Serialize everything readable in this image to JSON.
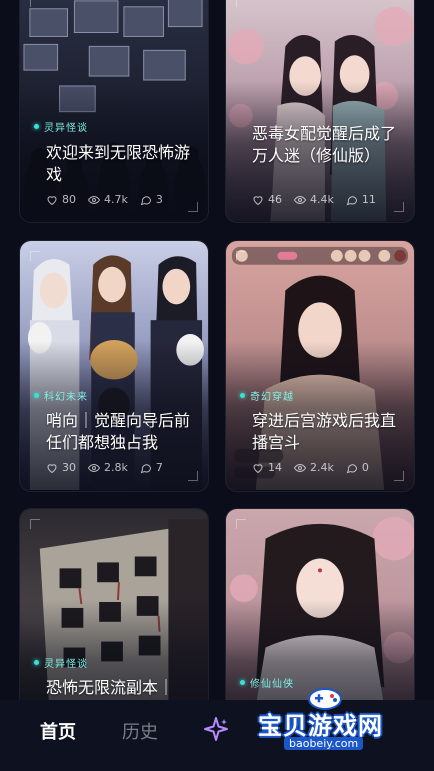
{
  "cards": [
    {
      "tag": "灵异怪谈",
      "title": "欢迎来到无限恐怖游戏",
      "likes": "80",
      "views": "4.7k",
      "comments": "3"
    },
    {
      "tag": "",
      "title": "恶毒女配觉醒后成了万人迷（修仙版）",
      "likes": "46",
      "views": "4.4k",
      "comments": "11"
    },
    {
      "tag": "科幻未来",
      "title": "哨向｜觉醒向导后前任们都想独占我",
      "likes": "30",
      "views": "2.8k",
      "comments": "7"
    },
    {
      "tag": "奇幻穿越",
      "title": "穿进后宫游戏后我直播宫斗",
      "likes": "14",
      "views": "2.4k",
      "comments": "0"
    },
    {
      "tag": "灵异怪谈",
      "title": "恐怖无限流副本｜",
      "likes": "",
      "views": "",
      "comments": ""
    },
    {
      "tag": "修仙仙侠",
      "title": "",
      "likes": "",
      "views": "",
      "comments": ""
    }
  ],
  "nav": {
    "home": "首页",
    "history": "历史",
    "star_icon": "sparkle-icon"
  },
  "watermark": {
    "text": "宝贝游戏网",
    "url": "baobeiy.com"
  },
  "colors": {
    "background": "#0b0e1a",
    "tag_accent": "#38e1d3",
    "nav_star": "#b78cff",
    "watermark_blue": "#1c57c9"
  }
}
